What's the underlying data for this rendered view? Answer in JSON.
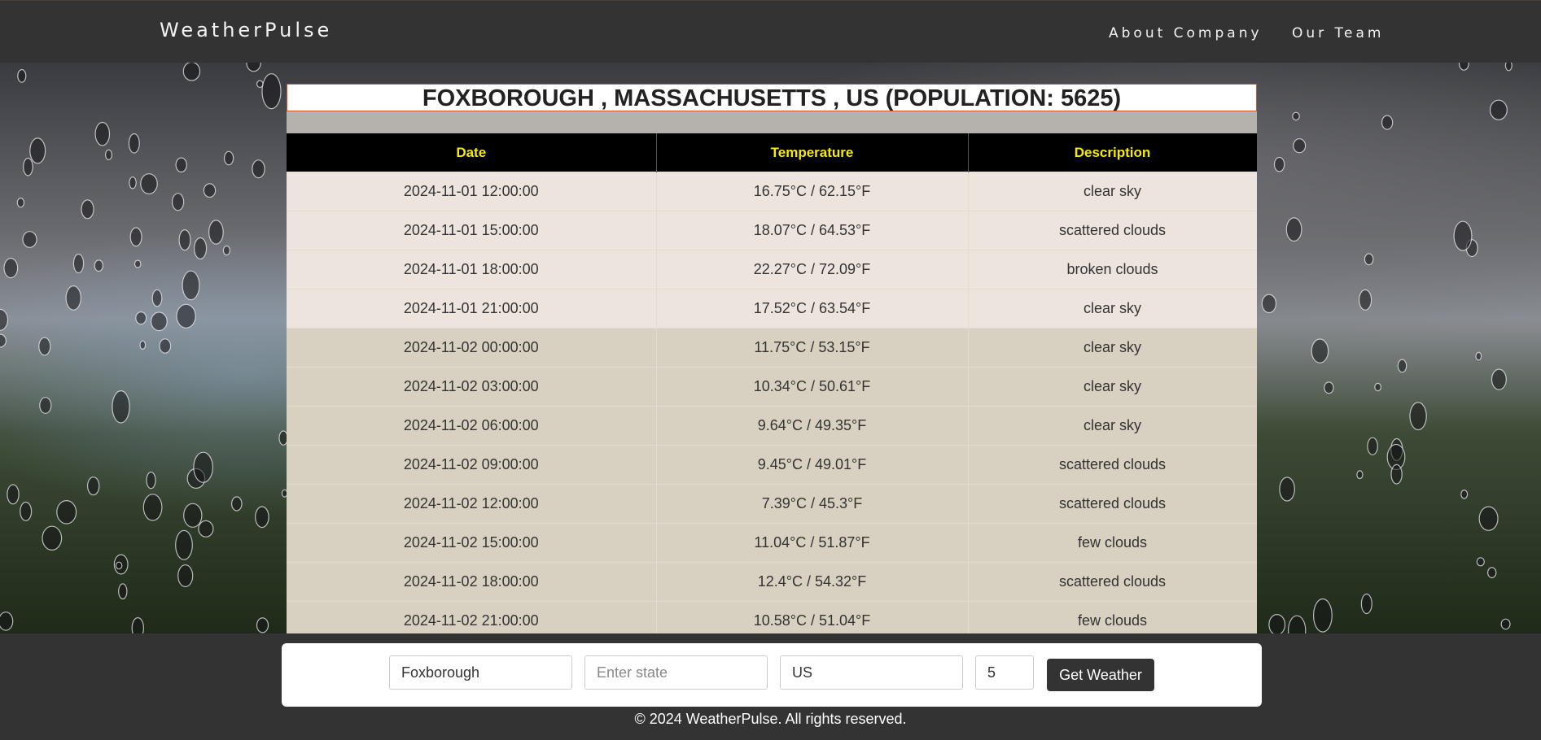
{
  "header": {
    "brand": "WeatherPulse",
    "nav": [
      {
        "label": "About Company"
      },
      {
        "label": "Our Team"
      }
    ]
  },
  "location": {
    "title": "FOXBOROUGH , MASSACHUSETTS , US (POPULATION: 5625)"
  },
  "table": {
    "columns": [
      "Date",
      "Temperature",
      "Description"
    ],
    "rows": [
      {
        "date": "2024-11-01 12:00:00",
        "temp": "16.75°C / 62.15°F",
        "desc": "clear sky"
      },
      {
        "date": "2024-11-01 15:00:00",
        "temp": "18.07°C / 64.53°F",
        "desc": "scattered clouds"
      },
      {
        "date": "2024-11-01 18:00:00",
        "temp": "22.27°C / 72.09°F",
        "desc": "broken clouds"
      },
      {
        "date": "2024-11-01 21:00:00",
        "temp": "17.52°C / 63.54°F",
        "desc": "clear sky"
      },
      {
        "date": "2024-11-02 00:00:00",
        "temp": "11.75°C / 53.15°F",
        "desc": "clear sky"
      },
      {
        "date": "2024-11-02 03:00:00",
        "temp": "10.34°C / 50.61°F",
        "desc": "clear sky"
      },
      {
        "date": "2024-11-02 06:00:00",
        "temp": "9.64°C / 49.35°F",
        "desc": "clear sky"
      },
      {
        "date": "2024-11-02 09:00:00",
        "temp": "9.45°C / 49.01°F",
        "desc": "scattered clouds"
      },
      {
        "date": "2024-11-02 12:00:00",
        "temp": "7.39°C / 45.3°F",
        "desc": "scattered clouds"
      },
      {
        "date": "2024-11-02 15:00:00",
        "temp": "11.04°C / 51.87°F",
        "desc": "few clouds"
      },
      {
        "date": "2024-11-02 18:00:00",
        "temp": "12.4°C / 54.32°F",
        "desc": "scattered clouds"
      },
      {
        "date": "2024-11-02 21:00:00",
        "temp": "10.58°C / 51.04°F",
        "desc": "few clouds"
      },
      {
        "date": "",
        "temp": "",
        "desc": ""
      }
    ]
  },
  "search": {
    "city_value": "Foxborough",
    "state_placeholder": "Enter state",
    "country_value": "US",
    "days_value": "5",
    "button_label": "Get Weather"
  },
  "footer": {
    "copyright": "© 2024 WeatherPulse. All rights reserved."
  },
  "colors": {
    "header_bg": "#333333",
    "table_header_bg": "#000000",
    "table_header_text": "#f5ec00",
    "row_day1": "#ede4de",
    "row_day2": "#d8d0c0",
    "title_border": "#d35b2a"
  }
}
